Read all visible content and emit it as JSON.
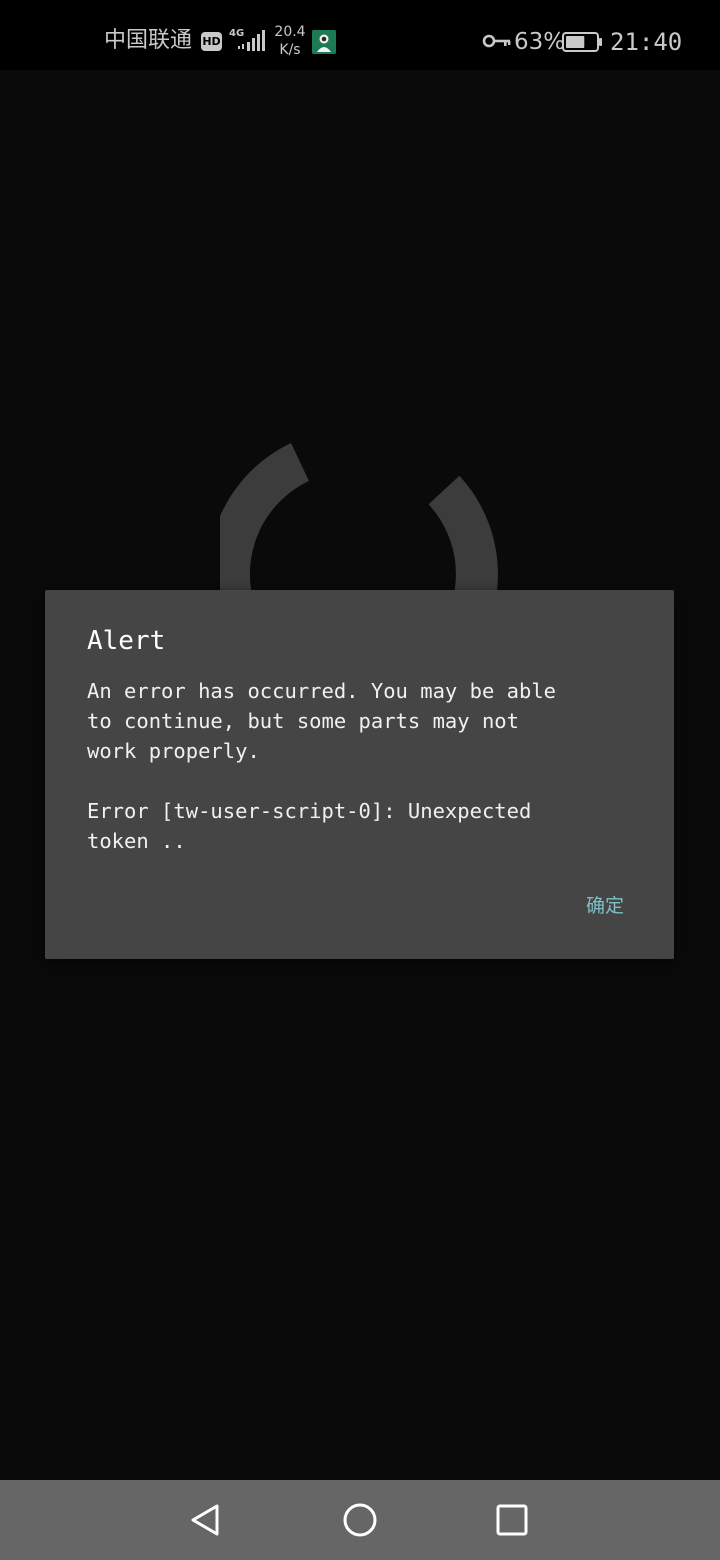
{
  "status_bar": {
    "carrier": "中国联通",
    "hd_badge": "HD",
    "network_type": "4G",
    "net_speed_value": "20.4",
    "net_speed_unit": "K/s",
    "battery_percent": "63%",
    "battery_level": 0.63,
    "clock": "21:40",
    "icons": [
      "hd-icon",
      "signal-icon",
      "app-notification-icon",
      "vpn-key-icon",
      "battery-icon"
    ]
  },
  "dialog": {
    "title": "Alert",
    "message": "An error has occurred. You may be able\nto continue, but some parts may not\nwork properly.\n\nError [tw-user-script-0]: Unexpected\ntoken ..",
    "ok_label": "确定",
    "ok_color": "#7ec0c4"
  },
  "nav_bar": {
    "icons": [
      "back-icon",
      "home-icon",
      "recents-icon"
    ]
  },
  "colors": {
    "background": "#0a0a0a",
    "dialog_background": "#454545",
    "spinner": "#3c3c3c",
    "nav_bar": "#666666"
  }
}
